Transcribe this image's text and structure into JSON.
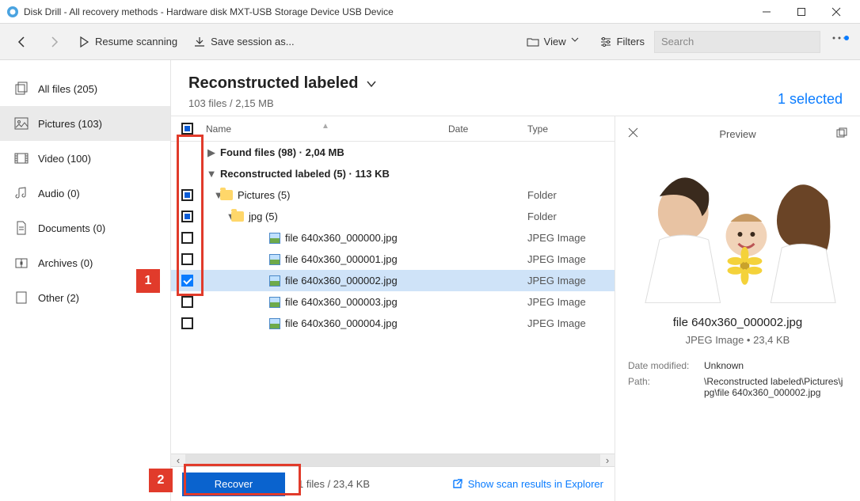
{
  "window": {
    "title": "Disk Drill - All recovery methods - Hardware disk MXT-USB Storage Device USB Device"
  },
  "toolbar": {
    "resume": "Resume scanning",
    "save": "Save session as...",
    "view": "View",
    "filters": "Filters",
    "search_placeholder": "Search"
  },
  "sidebar": {
    "items": [
      {
        "label": "All files (205)"
      },
      {
        "label": "Pictures (103)"
      },
      {
        "label": "Video (100)"
      },
      {
        "label": "Audio (0)"
      },
      {
        "label": "Documents (0)"
      },
      {
        "label": "Archives (0)"
      },
      {
        "label": "Other (2)"
      }
    ]
  },
  "heading": {
    "title": "Reconstructed labeled",
    "sub": "103 files / 2,15 MB",
    "selected": "1 selected"
  },
  "columns": {
    "name": "Name",
    "date": "Date",
    "type": "Type"
  },
  "rows": {
    "found": {
      "name": "Found files (98) · 2,04 MB"
    },
    "recon": {
      "name": "Reconstructed labeled (5) · 113 KB"
    },
    "pictures": {
      "name": "Pictures (5)",
      "type": "Folder"
    },
    "jpg": {
      "name": "jpg (5)",
      "type": "Folder"
    },
    "f0": {
      "name": "file 640x360_000000.jpg",
      "type": "JPEG Image"
    },
    "f1": {
      "name": "file 640x360_000001.jpg",
      "type": "JPEG Image"
    },
    "f2": {
      "name": "file 640x360_000002.jpg",
      "type": "JPEG Image"
    },
    "f3": {
      "name": "file 640x360_000003.jpg",
      "type": "JPEG Image"
    },
    "f4": {
      "name": "file 640x360_000004.jpg",
      "type": "JPEG Image"
    }
  },
  "preview": {
    "label": "Preview",
    "filename": "file 640x360_000002.jpg",
    "meta": "JPEG Image • 23,4 KB",
    "date_k": "Date modified:",
    "date_v": "Unknown",
    "path_k": "Path:",
    "path_v": "\\Reconstructed labeled\\Pictures\\jpg\\file 640x360_000002.jpg"
  },
  "footer": {
    "recover": "Recover",
    "status": "1 files / 23,4 KB",
    "link": "Show scan results in Explorer"
  },
  "callouts": {
    "n1": "1",
    "n2": "2"
  }
}
